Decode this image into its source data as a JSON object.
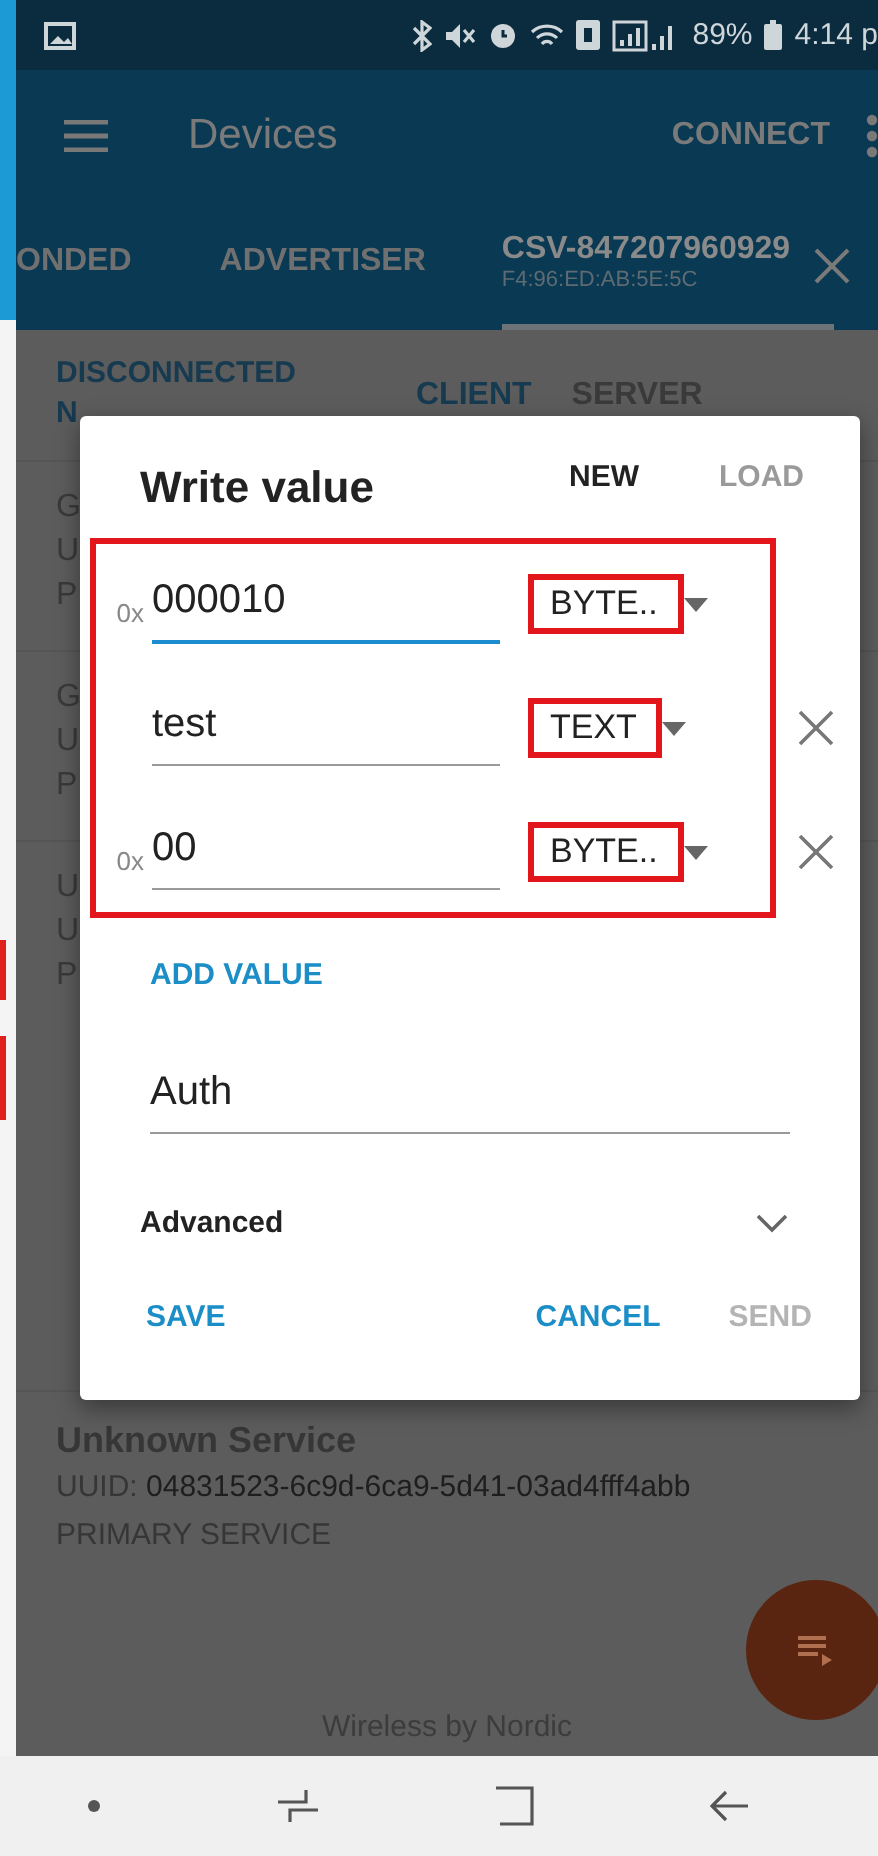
{
  "status_bar": {
    "battery": "89%",
    "time": "4:14 p"
  },
  "app_bar": {
    "title": "Devices",
    "action": "CONNECT"
  },
  "tabs": [
    {
      "label": "ONDED",
      "selected": false
    },
    {
      "label": "ADVERTISER",
      "selected": false
    },
    {
      "label": "CSV-847207960929",
      "sublabel": "F4:96:ED:AB:5E:5C",
      "selected": true
    }
  ],
  "connection": {
    "state": "DISCONNECTED",
    "bond": "N"
  },
  "role_tabs": [
    {
      "label": "CLIENT",
      "selected": true
    },
    {
      "label": "SERVER",
      "selected": false
    }
  ],
  "services": [
    {
      "kind": "covered",
      "lines": [
        "G",
        "U",
        "P"
      ]
    },
    {
      "kind": "covered",
      "lines": [
        "G",
        "U",
        "P"
      ]
    },
    {
      "kind": "covered",
      "lines": [
        "U",
        "U",
        "P"
      ]
    },
    {
      "kind": "full",
      "title": "Unknown Service",
      "uuid_label": "UUID:",
      "uuid": "04831523-6c9d-6ca9-5d41-03ad4fff4abb",
      "type": "PRIMARY SERVICE"
    }
  ],
  "footer": "Wireless by Nordic",
  "dialog": {
    "title": "Write value",
    "tabs": [
      {
        "label": "NEW",
        "selected": true
      },
      {
        "label": "LOAD",
        "selected": false
      }
    ],
    "values": [
      {
        "prefix": "0x",
        "value": "000010",
        "type": "BYTE..",
        "focused": true,
        "removable": false,
        "highlighted": true
      },
      {
        "value": "test",
        "type": "TEXT",
        "focused": false,
        "removable": true,
        "highlighted": true
      },
      {
        "prefix": "0x",
        "value": "00",
        "type": "BYTE..",
        "focused": false,
        "removable": true,
        "highlighted": true
      }
    ],
    "add_value": "ADD VALUE",
    "name": "Auth",
    "advanced": {
      "label": "Advanced",
      "expanded": false
    },
    "buttons": [
      {
        "label": "SAVE",
        "disabled": false
      },
      {
        "label": "CANCEL",
        "disabled": false
      },
      {
        "label": "SEND",
        "disabled": true
      }
    ]
  }
}
